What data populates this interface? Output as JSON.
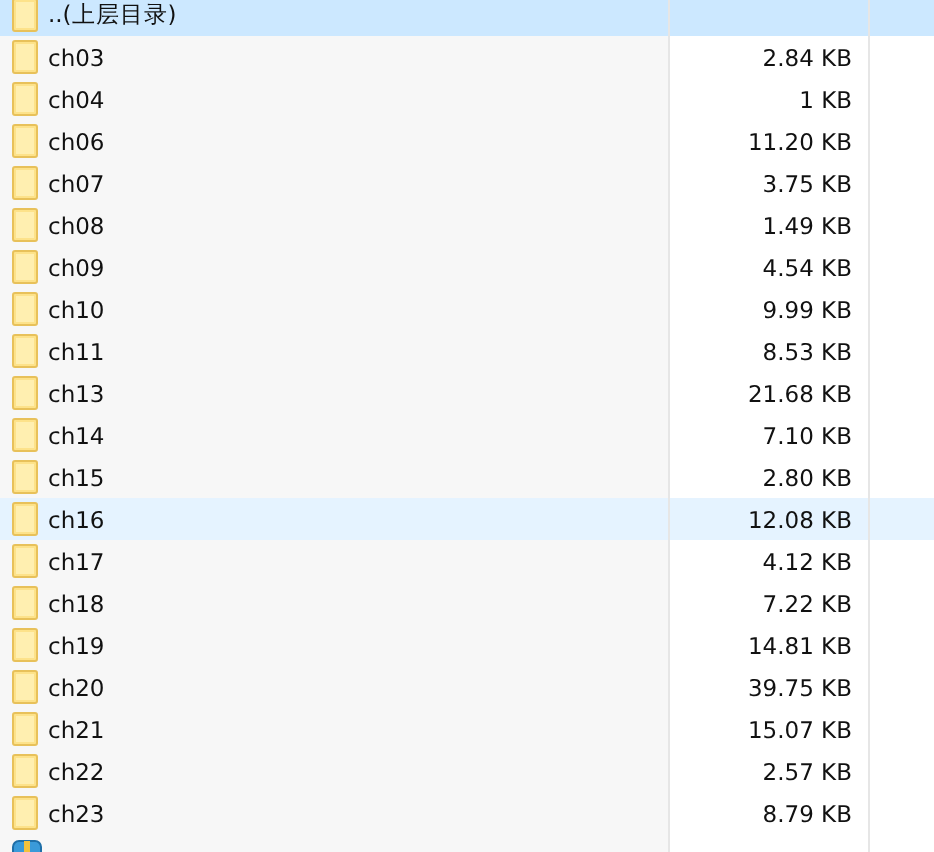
{
  "files": [
    {
      "kind": "parent",
      "name": "..(上层目录)",
      "selected": true,
      "hovered": false
    },
    {
      "kind": "folder",
      "name": "ch03",
      "size": "2.84 KB",
      "selected": false,
      "hovered": false
    },
    {
      "kind": "folder",
      "name": "ch04",
      "size": "1 KB",
      "selected": false,
      "hovered": false
    },
    {
      "kind": "folder",
      "name": "ch06",
      "size": "11.20 KB",
      "selected": false,
      "hovered": false
    },
    {
      "kind": "folder",
      "name": "ch07",
      "size": "3.75 KB",
      "selected": false,
      "hovered": false
    },
    {
      "kind": "folder",
      "name": "ch08",
      "size": "1.49 KB",
      "selected": false,
      "hovered": false
    },
    {
      "kind": "folder",
      "name": "ch09",
      "size": "4.54 KB",
      "selected": false,
      "hovered": false
    },
    {
      "kind": "folder",
      "name": "ch10",
      "size": "9.99 KB",
      "selected": false,
      "hovered": false
    },
    {
      "kind": "folder",
      "name": "ch11",
      "size": "8.53 KB",
      "selected": false,
      "hovered": false
    },
    {
      "kind": "folder",
      "name": "ch13",
      "size": "21.68 KB",
      "selected": false,
      "hovered": false
    },
    {
      "kind": "folder",
      "name": "ch14",
      "size": "7.10 KB",
      "selected": false,
      "hovered": false
    },
    {
      "kind": "folder",
      "name": "ch15",
      "size": "2.80 KB",
      "selected": false,
      "hovered": false
    },
    {
      "kind": "folder",
      "name": "ch16",
      "size": "12.08 KB",
      "selected": false,
      "hovered": true
    },
    {
      "kind": "folder",
      "name": "ch17",
      "size": "4.12 KB",
      "selected": false,
      "hovered": false
    },
    {
      "kind": "folder",
      "name": "ch18",
      "size": "7.22 KB",
      "selected": false,
      "hovered": false
    },
    {
      "kind": "folder",
      "name": "ch19",
      "size": "14.81 KB",
      "selected": false,
      "hovered": false
    },
    {
      "kind": "folder",
      "name": "ch20",
      "size": "39.75 KB",
      "selected": false,
      "hovered": false
    },
    {
      "kind": "folder",
      "name": "ch21",
      "size": "15.07 KB",
      "selected": false,
      "hovered": false
    },
    {
      "kind": "folder",
      "name": "ch22",
      "size": "2.57 KB",
      "selected": false,
      "hovered": false
    },
    {
      "kind": "folder",
      "name": "ch23",
      "size": "8.79 KB",
      "selected": false,
      "hovered": false
    },
    {
      "kind": "archive",
      "selected": false,
      "hovered": false
    }
  ]
}
